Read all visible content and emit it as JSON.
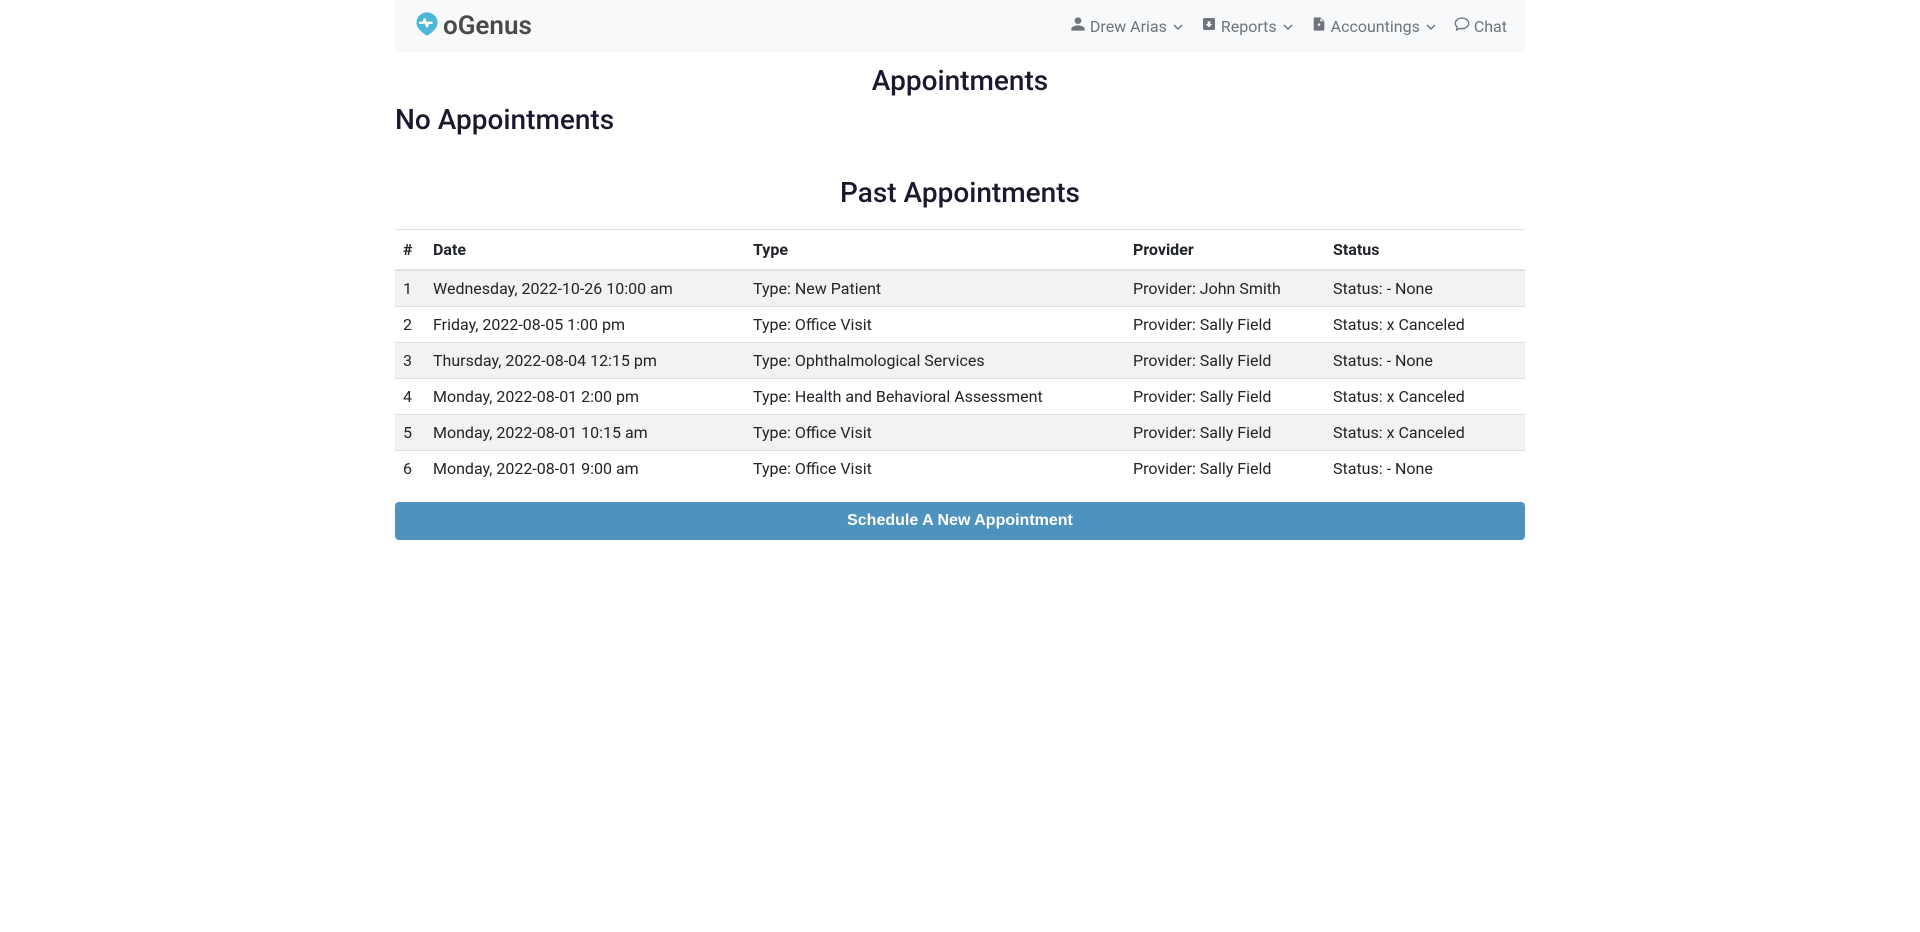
{
  "brand": {
    "text": "oGenus"
  },
  "nav": {
    "user": "Drew Arias",
    "reports": "Reports",
    "accountings": "Accountings",
    "chat": "Chat"
  },
  "titles": {
    "appointments": "Appointments",
    "no_appointments": "No Appointments",
    "past_appointments": "Past Appointments"
  },
  "table": {
    "headers": {
      "num": "#",
      "date": "Date",
      "type": "Type",
      "provider": "Provider",
      "status": "Status"
    },
    "rows": [
      {
        "num": "1",
        "date": "Wednesday, 2022-10-26 10:00 am",
        "type": "Type: New Patient",
        "provider": "Provider: John Smith",
        "status": "Status: - None"
      },
      {
        "num": "2",
        "date": "Friday, 2022-08-05 1:00 pm",
        "type": "Type: Office Visit",
        "provider": "Provider: Sally Field",
        "status": "Status: x Canceled"
      },
      {
        "num": "3",
        "date": "Thursday, 2022-08-04 12:15 pm",
        "type": "Type: Ophthalmological Services",
        "provider": "Provider: Sally Field",
        "status": "Status: - None"
      },
      {
        "num": "4",
        "date": "Monday, 2022-08-01 2:00 pm",
        "type": "Type: Health and Behavioral Assessment",
        "provider": "Provider: Sally Field",
        "status": "Status: x Canceled"
      },
      {
        "num": "5",
        "date": "Monday, 2022-08-01 10:15 am",
        "type": "Type: Office Visit",
        "provider": "Provider: Sally Field",
        "status": "Status: x Canceled"
      },
      {
        "num": "6",
        "date": "Monday, 2022-08-01 9:00 am",
        "type": "Type: Office Visit",
        "provider": "Provider: Sally Field",
        "status": "Status: - None"
      }
    ]
  },
  "button": {
    "schedule": "Schedule A New Appointment"
  }
}
